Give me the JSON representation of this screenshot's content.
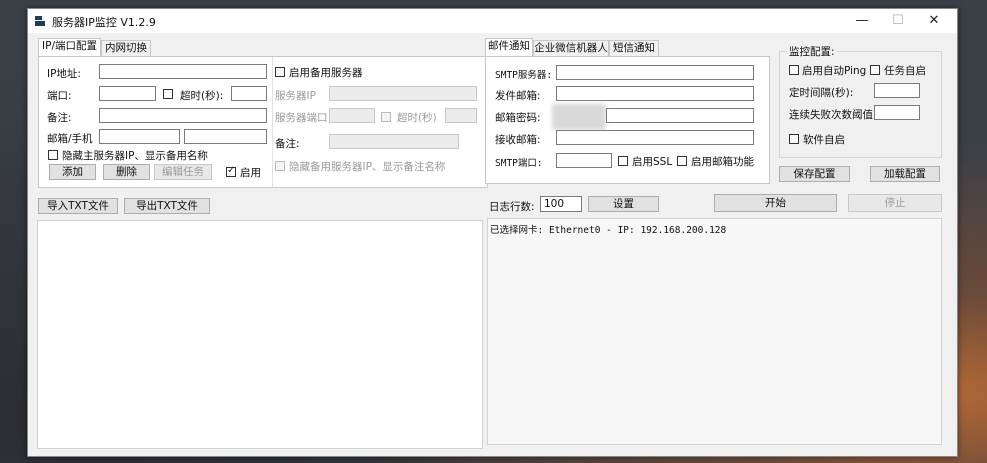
{
  "window": {
    "title": "服务器IP监控 V1.2.9",
    "minimize": "—",
    "maximize": "☐",
    "close": "✕"
  },
  "left_tabs": [
    "IP/端口配置",
    "内网切换"
  ],
  "ip_config": {
    "ip_label": "IP地址:",
    "port_label": "端口:",
    "timeout_label": "超时(秒):",
    "note_label": "备注:",
    "mail_label": "邮箱/手机",
    "hide_check": "隐藏主服务器IP、显示备用名称",
    "add_btn": "添加",
    "delete_btn": "删除",
    "edit_btn": "编辑任务",
    "enable_check": "启用"
  },
  "backup": {
    "enable_check": "启用备用服务器",
    "server_ip_label": "服务器IP",
    "server_port_label": "服务器端口",
    "timeout_label": "超时(秒)",
    "note_label": "备注:",
    "hide_check": "隐藏备用服务器IP、显示备注名称"
  },
  "import_btn": "导入TXT文件",
  "export_btn": "导出TXT文件",
  "mid_tabs": [
    "邮件通知",
    "企业微信机器人",
    "短信通知"
  ],
  "mail": {
    "smtp_server_label": "SMTP服务器:",
    "sender_label": "发件邮箱:",
    "password_label": "邮箱密码:",
    "receiver_label": "接收邮箱:",
    "smtp_port_label": "SMTP端口:",
    "ssl_check": "启用SSL",
    "enable_mail_check": "启用邮箱功能"
  },
  "monitor": {
    "title": "监控配置:",
    "auto_ping_check": "启用自动Ping",
    "task_autostart_check": "任务自启",
    "interval_label": "定时间隔(秒):",
    "fail_threshold_label": "连续失败次数阈值",
    "software_autostart_check": "软件自启",
    "save_btn": "保存配置",
    "load_btn": "加载配置"
  },
  "log": {
    "lines_label": "日志行数:",
    "lines_value": "100",
    "set_btn": "设置",
    "start_btn": "开始",
    "stop_btn": "停止",
    "text": "已选择网卡: Ethernet0 - IP: 192.168.200.128"
  }
}
